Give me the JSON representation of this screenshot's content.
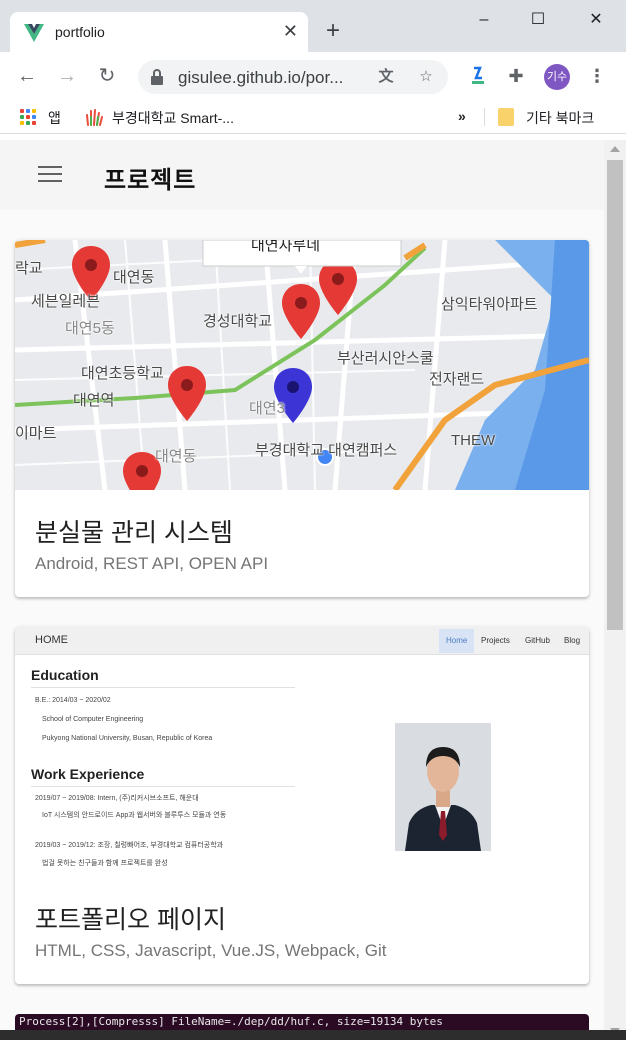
{
  "browser": {
    "tab_title": "portfolio",
    "tab_close": "✕",
    "new_tab": "+",
    "window_controls": {
      "minimize": "–",
      "maximize": "☐",
      "close": "✕"
    },
    "url": "gisulee.github.io/por...",
    "profile_initials": "기수",
    "icons": [
      "back-icon",
      "forward-icon",
      "reload-icon",
      "lock-icon",
      "translate-icon",
      "star-icon",
      "extension-icon",
      "puzzle-icon",
      "menu-dots-icon"
    ]
  },
  "bookmarks": {
    "apps_label": "앱",
    "item_label": "부경대학교 Smart-...",
    "overflow": "»",
    "other_label": "기타 북마크"
  },
  "appbar": {
    "title": "프로젝트"
  },
  "cards": [
    {
      "title": "분실물 관리 시스템",
      "subtitle": "Android, REST API, OPEN API",
      "map": {
        "popup_label": "대연자루네",
        "labels": [
          "대연동",
          "세븐일레븐",
          "대연5동",
          "경성대학교",
          "삼익타워아파트",
          "대연초등학교",
          "부산러시안스쿨",
          "전자랜드",
          "대연역",
          "대연3",
          "이마트",
          "부경대학교 대연캠퍼스",
          "THEW",
          "대연동",
          "락교"
        ]
      }
    },
    {
      "title": "포트폴리오 페이지",
      "subtitle": "HTML, CSS, Javascript, Vue.JS, Webpack, Git",
      "preview": {
        "nav_home": "HOME",
        "nav_links": [
          "Home",
          "Projects",
          "GitHub",
          "Blog"
        ],
        "education_heading": "Education",
        "education_lines": [
          "B.E.: 2014/03 ~ 2020/02",
          "School of Computer Engineering",
          "Pukyong National University, Busan, Republic of Korea"
        ],
        "work_heading": "Work Experience",
        "work_lines": [
          "2019/07 ~ 2019/08: Intern, (주)리커시브소프트, 해운대",
          "IoT 시스템의 안드로이드 App과 웹서버와 블루투스 모듈과 연동",
          "2019/03 ~ 2019/12: 조장, 칠렁빠어조, 부경대학교 컴퓨터공학과",
          "법걸 못하는 친구들과 함께 프로젝트를 완성"
        ]
      }
    }
  ],
  "terminal": {
    "line": "Process[2],[Compresss] FileName=./dep/dd/huf.c, size=19134 bytes"
  },
  "colors": {
    "map_marker": "#e53935",
    "map_marker_self": "#3d34d6",
    "brand_vue": "#41b883"
  }
}
